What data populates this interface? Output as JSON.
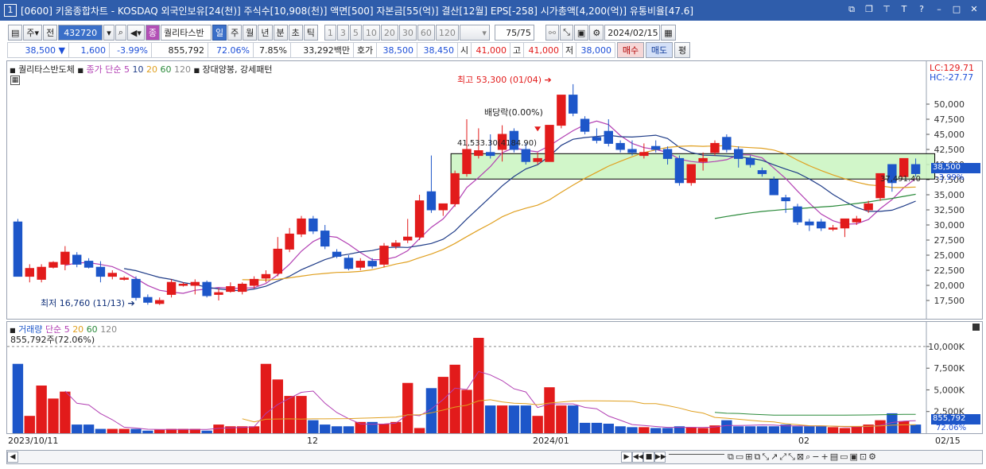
{
  "window": {
    "title": "[0600] 키움종합차트 - KOSDAQ 외국인보유[24(천)] 주식수[10,908(천)] 액면[500] 자본금[55(억)] 결산[12월] EPS[-258] 시가총액[4,200(억)] 유통비율[47.6]",
    "icon_label": "1"
  },
  "toolbar": {
    "period_label": "주",
    "all_label": "전",
    "code": "432720",
    "badge_label": "종",
    "stock_name": "퀄리타스반",
    "period_buttons": [
      "일",
      "주",
      "월",
      "년",
      "분",
      "초",
      "틱"
    ],
    "active_period": "일",
    "interval_buttons": [
      "1",
      "3",
      "5",
      "10",
      "20",
      "30",
      "60",
      "120"
    ],
    "count_value": "75",
    "count_total": "/75",
    "date_value": "2024/02/15"
  },
  "quote": {
    "price": "38,500",
    "change": "1,600",
    "change_pct": "-3.99%",
    "volume": "855,792",
    "ratio1": "72.06%",
    "ratio2": "7.85%",
    "amount": "33,292백만",
    "hoga_label": "호가",
    "hoga_ask": "38,500",
    "hoga_bid": "38,450",
    "open_label": "시",
    "open": "41,000",
    "high_label": "고",
    "high": "41,000",
    "low_label": "저",
    "low": "38,000",
    "buy_label": "매수",
    "sell_label": "매도",
    "eval_label": "평"
  },
  "price_panel": {
    "stock_tag": "퀄리타스반도체",
    "ma_title": "종가 단순",
    "ma_periods": [
      "5",
      "10",
      "20",
      "60",
      "120"
    ],
    "pattern_text": "장대양봉, 강세패턴",
    "lc_label": "LC:129.71",
    "hc_label": "HC:-27.77",
    "high_annot": "최고 53,300 (01/04)",
    "low_annot": "최저 16,760 (11/13)",
    "div_annot": "배당락(0.00%)",
    "box_annot": "41,533.30(4184.90)",
    "level_annot": "37,491.40",
    "current_tag": "38,500",
    "current_pct": "-3.99%",
    "y_ticks": [
      "50,000",
      "47,500",
      "45,000",
      "42,500",
      "40,000",
      "37,500",
      "35,000",
      "32,500",
      "30,000",
      "27,500",
      "25,000",
      "22,500",
      "20,000",
      "17,500"
    ]
  },
  "volume_panel": {
    "title": "거래량",
    "ma_title": "단순",
    "ma_periods": [
      "5",
      "20",
      "60",
      "120"
    ],
    "value_text": "855,792주(72.06%)",
    "current_tag": "855,792",
    "current_pct": "72.06%",
    "y_ticks": [
      "10,000K",
      "7,500K",
      "5,000K",
      "2,500K"
    ]
  },
  "x_labels": [
    "2023/10/11",
    "12",
    "2024/01",
    "02",
    "02/15"
  ],
  "chart_data": [
    {
      "type": "candlestick",
      "title": "",
      "ylim": [
        15000,
        55000
      ],
      "candles": [
        {
          "o": 30500,
          "h": 31000,
          "l": 22000,
          "c": 21500
        },
        {
          "o": 21500,
          "h": 23500,
          "l": 20500,
          "c": 22800
        },
        {
          "o": 21000,
          "h": 23500,
          "l": 20500,
          "c": 23000
        },
        {
          "o": 23000,
          "h": 24000,
          "l": 22800,
          "c": 23800
        },
        {
          "o": 23500,
          "h": 26500,
          "l": 22500,
          "c": 25500
        },
        {
          "o": 25000,
          "h": 25500,
          "l": 23000,
          "c": 23500
        },
        {
          "o": 24000,
          "h": 24500,
          "l": 22800,
          "c": 23000
        },
        {
          "o": 23000,
          "h": 24000,
          "l": 20500,
          "c": 21500
        },
        {
          "o": 21500,
          "h": 22500,
          "l": 21000,
          "c": 22000
        },
        {
          "o": 21000,
          "h": 21500,
          "l": 20800,
          "c": 21200
        },
        {
          "o": 21000,
          "h": 21500,
          "l": 17500,
          "c": 18000
        },
        {
          "o": 18000,
          "h": 18500,
          "l": 16800,
          "c": 17200
        },
        {
          "o": 17000,
          "h": 18000,
          "l": 16760,
          "c": 17500
        },
        {
          "o": 18500,
          "h": 21000,
          "l": 18000,
          "c": 20500
        },
        {
          "o": 20000,
          "h": 20500,
          "l": 19800,
          "c": 20200
        },
        {
          "o": 20000,
          "h": 21000,
          "l": 18500,
          "c": 20500
        },
        {
          "o": 20500,
          "h": 20800,
          "l": 18000,
          "c": 18300
        },
        {
          "o": 18500,
          "h": 19500,
          "l": 17500,
          "c": 18800
        },
        {
          "o": 19000,
          "h": 20500,
          "l": 18800,
          "c": 19800
        },
        {
          "o": 19000,
          "h": 20500,
          "l": 18500,
          "c": 20200
        },
        {
          "o": 20000,
          "h": 21500,
          "l": 19500,
          "c": 21000
        },
        {
          "o": 21200,
          "h": 22500,
          "l": 20500,
          "c": 21800
        },
        {
          "o": 22000,
          "h": 28000,
          "l": 21500,
          "c": 26000
        },
        {
          "o": 26000,
          "h": 29500,
          "l": 25500,
          "c": 28500
        },
        {
          "o": 28500,
          "h": 31500,
          "l": 28000,
          "c": 31000
        },
        {
          "o": 31000,
          "h": 31500,
          "l": 28500,
          "c": 29000
        },
        {
          "o": 29000,
          "h": 30000,
          "l": 26000,
          "c": 26500
        },
        {
          "o": 25500,
          "h": 26000,
          "l": 24500,
          "c": 24800
        },
        {
          "o": 24500,
          "h": 25000,
          "l": 22500,
          "c": 22800
        },
        {
          "o": 23000,
          "h": 24500,
          "l": 22500,
          "c": 24000
        },
        {
          "o": 24000,
          "h": 24500,
          "l": 22800,
          "c": 23200
        },
        {
          "o": 23500,
          "h": 27000,
          "l": 23000,
          "c": 26500
        },
        {
          "o": 26500,
          "h": 27500,
          "l": 26000,
          "c": 27000
        },
        {
          "o": 27500,
          "h": 31000,
          "l": 27000,
          "c": 28000
        },
        {
          "o": 28000,
          "h": 35000,
          "l": 27500,
          "c": 34000
        },
        {
          "o": 35500,
          "h": 41500,
          "l": 32000,
          "c": 32500
        },
        {
          "o": 32500,
          "h": 33500,
          "l": 31500,
          "c": 33500
        },
        {
          "o": 33500,
          "h": 39000,
          "l": 33000,
          "c": 38500
        },
        {
          "o": 38500,
          "h": 47500,
          "l": 38000,
          "c": 42500
        },
        {
          "o": 41500,
          "h": 46000,
          "l": 41000,
          "c": 42300
        },
        {
          "o": 42000,
          "h": 45000,
          "l": 41000,
          "c": 41500
        },
        {
          "o": 42500,
          "h": 46500,
          "l": 40500,
          "c": 45000
        },
        {
          "o": 45500,
          "h": 46000,
          "l": 42000,
          "c": 42500
        },
        {
          "o": 42500,
          "h": 43500,
          "l": 40000,
          "c": 40500
        },
        {
          "o": 40500,
          "h": 42000,
          "l": 40000,
          "c": 41000
        },
        {
          "o": 40500,
          "h": 46500,
          "l": 40500,
          "c": 46500
        },
        {
          "o": 46500,
          "h": 51000,
          "l": 46000,
          "c": 51500
        },
        {
          "o": 51500,
          "h": 53300,
          "l": 48000,
          "c": 48500
        },
        {
          "o": 47500,
          "h": 48000,
          "l": 45000,
          "c": 45500
        },
        {
          "o": 44500,
          "h": 46000,
          "l": 43500,
          "c": 44000
        },
        {
          "o": 45500,
          "h": 47500,
          "l": 43000,
          "c": 43500
        },
        {
          "o": 43500,
          "h": 44000,
          "l": 42000,
          "c": 42500
        },
        {
          "o": 42500,
          "h": 44000,
          "l": 41500,
          "c": 42000
        },
        {
          "o": 41500,
          "h": 43500,
          "l": 41000,
          "c": 42000
        },
        {
          "o": 43000,
          "h": 44000,
          "l": 42000,
          "c": 42500
        },
        {
          "o": 42500,
          "h": 43000,
          "l": 40000,
          "c": 41000
        },
        {
          "o": 41000,
          "h": 41500,
          "l": 36500,
          "c": 37000
        },
        {
          "o": 37000,
          "h": 40000,
          "l": 36500,
          "c": 40000
        },
        {
          "o": 40500,
          "h": 42000,
          "l": 39000,
          "c": 41000
        },
        {
          "o": 42000,
          "h": 44000,
          "l": 41500,
          "c": 43500
        },
        {
          "o": 44500,
          "h": 45000,
          "l": 42000,
          "c": 42500
        },
        {
          "o": 42500,
          "h": 43000,
          "l": 39500,
          "c": 41000
        },
        {
          "o": 41000,
          "h": 41500,
          "l": 39500,
          "c": 40000
        },
        {
          "o": 39000,
          "h": 39500,
          "l": 38000,
          "c": 38500
        },
        {
          "o": 37500,
          "h": 38000,
          "l": 35000,
          "c": 35000
        },
        {
          "o": 34500,
          "h": 35000,
          "l": 32000,
          "c": 34000
        },
        {
          "o": 33000,
          "h": 33500,
          "l": 30000,
          "c": 30500
        },
        {
          "o": 30500,
          "h": 31000,
          "l": 29000,
          "c": 30000
        },
        {
          "o": 30500,
          "h": 31000,
          "l": 29000,
          "c": 29500
        },
        {
          "o": 29500,
          "h": 30000,
          "l": 29000,
          "c": 29500
        },
        {
          "o": 29500,
          "h": 31000,
          "l": 28000,
          "c": 31000
        },
        {
          "o": 30500,
          "h": 31500,
          "l": 30000,
          "c": 31000
        },
        {
          "o": 32500,
          "h": 34000,
          "l": 32000,
          "c": 33500
        },
        {
          "o": 34500,
          "h": 38500,
          "l": 34000,
          "c": 38500
        },
        {
          "o": 40000,
          "h": 40000,
          "l": 35500,
          "c": 37000
        },
        {
          "o": 38000,
          "h": 41000,
          "l": 38000,
          "c": 41000
        },
        {
          "o": 40000,
          "h": 41000,
          "l": 38000,
          "c": 38500
        }
      ],
      "volume": [
        8000,
        2000,
        5500,
        4000,
        4800,
        1000,
        1000,
        500,
        500,
        500,
        500,
        300,
        400,
        500,
        500,
        500,
        300,
        1000,
        800,
        800,
        800,
        8000,
        6200,
        4300,
        4300,
        1500,
        1000,
        800,
        800,
        1300,
        1300,
        1100,
        1300,
        5800,
        600,
        5200,
        6500,
        7900,
        5000,
        11000,
        3200,
        3200,
        3200,
        3200,
        2000,
        5300,
        3200,
        3200,
        1200,
        1200,
        1100,
        800,
        700,
        700,
        600,
        600,
        800,
        700,
        600,
        900,
        1500,
        800,
        800,
        800,
        800,
        1000,
        800,
        800,
        800,
        700,
        600,
        800,
        1000,
        1500,
        2300,
        1400,
        1000
      ]
    }
  ],
  "colors": {
    "title_bg": "#2f5dab",
    "up": "#e21b1b",
    "down": "#1d56c9",
    "ma5": "#b23fb3",
    "ma10": "#1f3c88",
    "ma20": "#e0a020",
    "ma60": "#2a8a3a",
    "box_fill": "#c9f5c0"
  }
}
